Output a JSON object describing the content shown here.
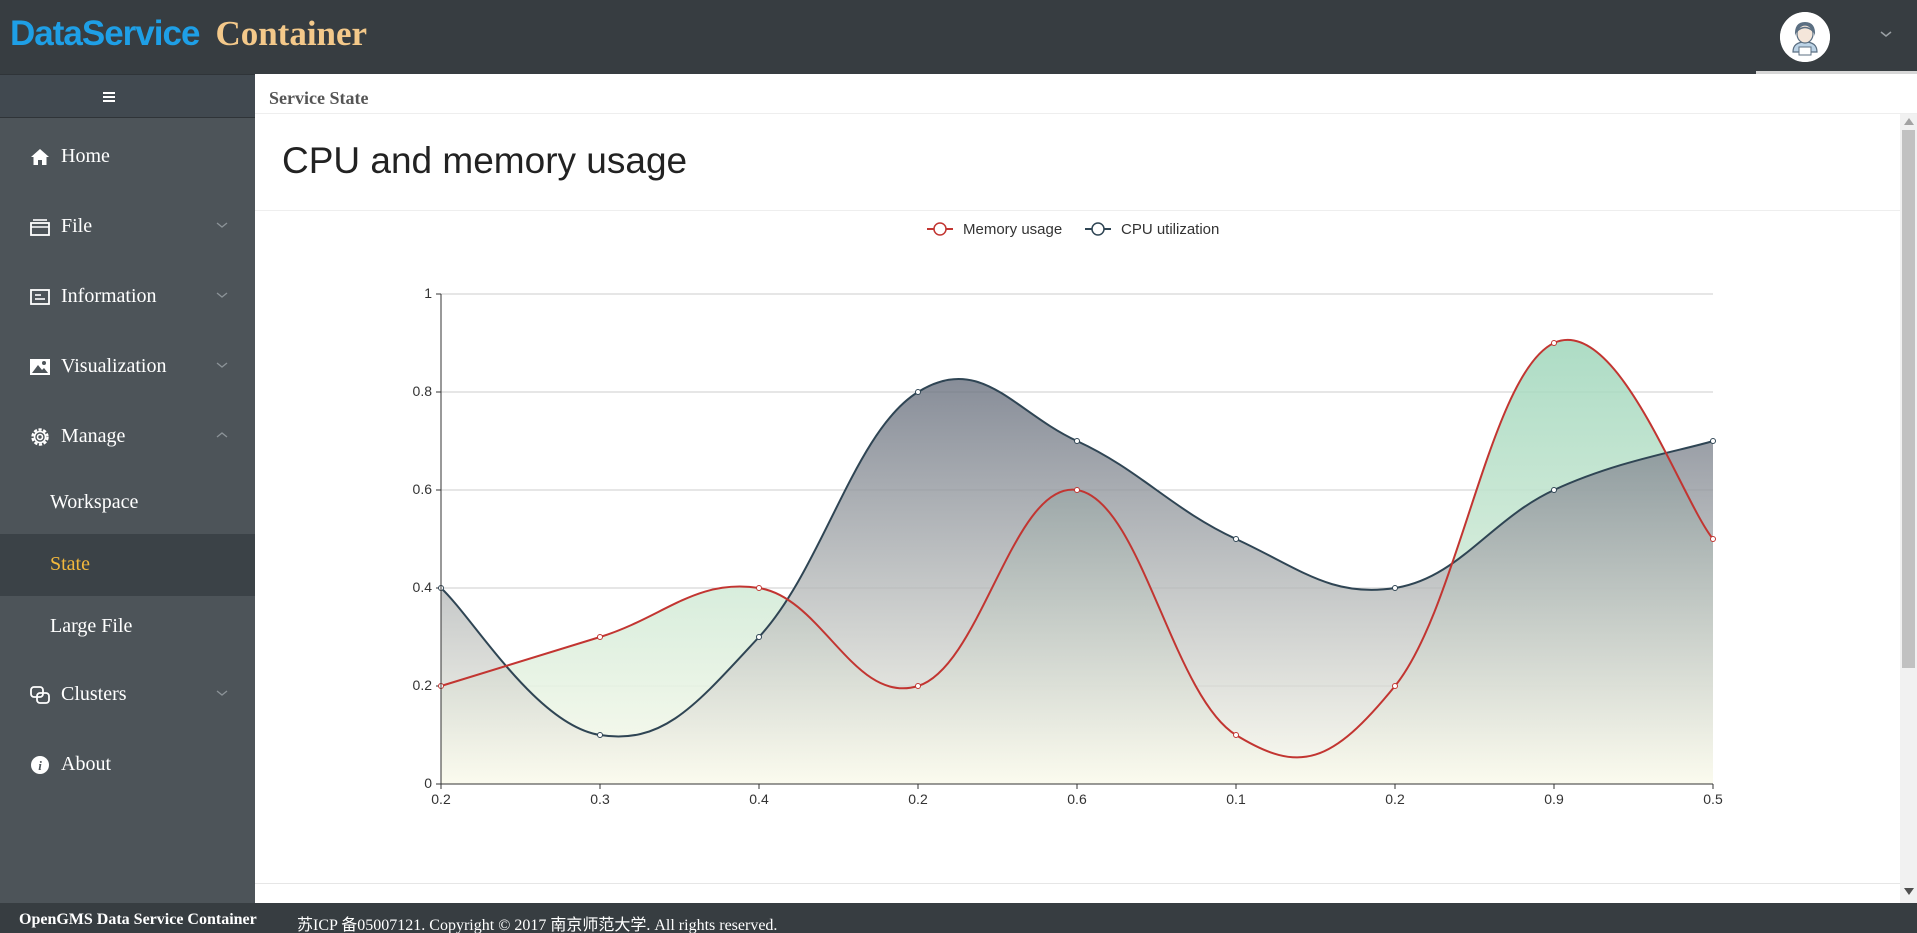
{
  "header": {
    "logo_part1": "Data",
    "logo_part2": "Service",
    "logo_part3": "Container"
  },
  "sidebar": {
    "items": [
      {
        "label": "Home",
        "icon": "home-icon"
      },
      {
        "label": "File",
        "icon": "file-icon",
        "expanded": false
      },
      {
        "label": "Information",
        "icon": "information-icon",
        "expanded": false
      },
      {
        "label": "Visualization",
        "icon": "image-icon",
        "expanded": false
      },
      {
        "label": "Manage",
        "icon": "gear-icon",
        "expanded": true
      },
      {
        "label": "Clusters",
        "icon": "clusters-icon",
        "expanded": false
      },
      {
        "label": "About",
        "icon": "info-icon"
      }
    ],
    "manage_sub": [
      {
        "label": "Workspace"
      },
      {
        "label": "State",
        "active": true
      },
      {
        "label": "Large File"
      }
    ]
  },
  "main": {
    "breadcrumb": "Service State",
    "card_title": "CPU and memory usage"
  },
  "footer": {
    "brand": "OpenGMS Data Service Container",
    "copyright": "苏ICP 备05007121. Copyright © 2017 南京师范大学. All rights reserved."
  },
  "colors": {
    "accent_active": "#f3b83c",
    "memory_series": "#c23531",
    "cpu_series": "#2f4554"
  },
  "chart_data": {
    "type": "area",
    "categories": [
      "0.2",
      "0.3",
      "0.4",
      "0.2",
      "0.6",
      "0.1",
      "0.2",
      "0.9",
      "0.5"
    ],
    "series": [
      {
        "name": "Memory usage",
        "values": [
          0.2,
          0.3,
          0.4,
          0.2,
          0.6,
          0.1,
          0.2,
          0.9,
          0.5
        ]
      },
      {
        "name": "CPU utilization",
        "values": [
          0.4,
          0.1,
          0.3,
          0.8,
          0.7,
          0.5,
          0.4,
          0.6,
          0.7
        ]
      }
    ],
    "ylim": [
      0,
      1
    ],
    "yticks": [
      "0",
      "0.2",
      "0.4",
      "0.6",
      "0.8",
      "1"
    ],
    "legend": "top-center",
    "grid": true,
    "smooth": true
  }
}
